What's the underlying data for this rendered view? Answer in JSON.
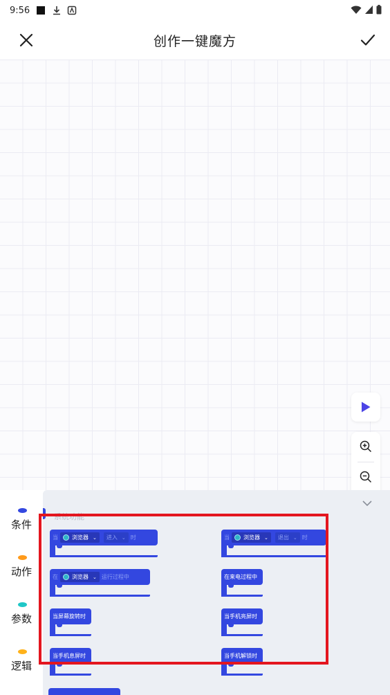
{
  "status_bar": {
    "time": "9:56"
  },
  "header": {
    "title": "创作一键魔方"
  },
  "categories": [
    {
      "label": "条件",
      "color": "#3347e0"
    },
    {
      "label": "动作",
      "color": "#ff9a1a"
    },
    {
      "label": "参数",
      "color": "#1fc7c7"
    },
    {
      "label": "逻辑",
      "color": "#ffb21a"
    }
  ],
  "palette": {
    "section_title": "系统功能",
    "blocks": {
      "b1": {
        "prefix": "当",
        "app": "浏览器",
        "action": "进入",
        "suffix": "时"
      },
      "b2": {
        "prefix": "当",
        "app": "浏览器",
        "action": "退出",
        "suffix": "时"
      },
      "b3": {
        "prefix": "在",
        "app": "浏览器",
        "suffix": "运行过程中"
      },
      "b4": {
        "label": "在来电过程中"
      },
      "b5": {
        "label": "当屏幕旋转时"
      },
      "b6": {
        "label": "当手机亮屏时"
      },
      "b7": {
        "label": "当手机息屏时"
      },
      "b8": {
        "label": "当手机解锁时"
      }
    }
  },
  "colors": {
    "accent": "#3347e0",
    "highlight": "#e3161f"
  }
}
